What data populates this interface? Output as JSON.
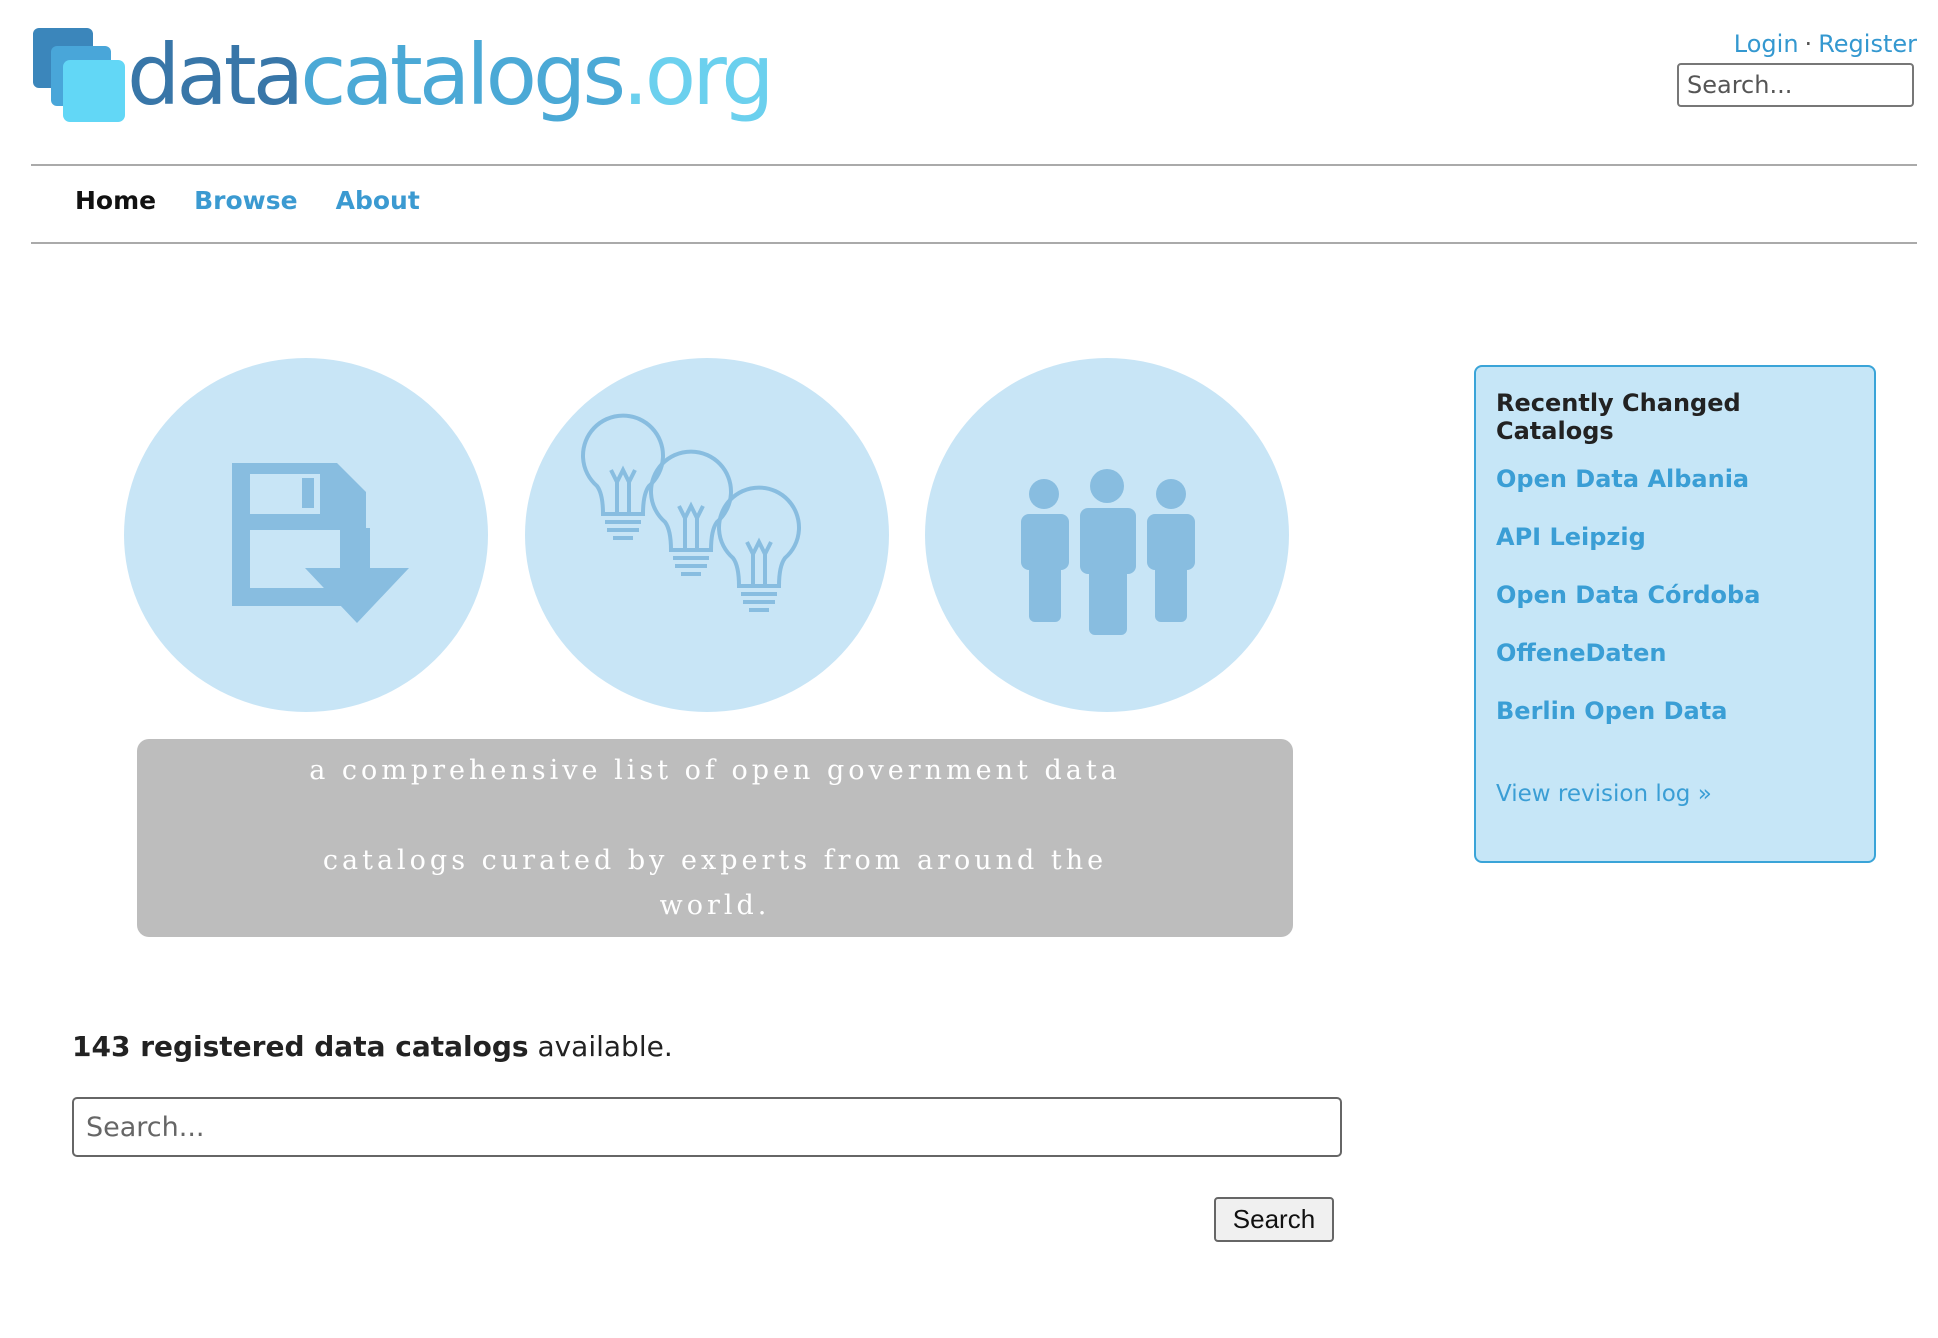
{
  "logo": {
    "part1": "data",
    "part2": "catalogs",
    "part3": ".org"
  },
  "header": {
    "login_label": "Login",
    "separator": "·",
    "register_label": "Register",
    "search_placeholder": "Search..."
  },
  "nav": {
    "items": [
      {
        "label": "Home",
        "active": true
      },
      {
        "label": "Browse",
        "active": false
      },
      {
        "label": "About",
        "active": false
      }
    ]
  },
  "hero": {
    "icons": [
      "floppy-download-icon",
      "lightbulbs-icon",
      "people-icon"
    ],
    "tagline_line1": "a comprehensive list of open government data",
    "tagline_line2": "catalogs curated by experts from around the world."
  },
  "sidebar": {
    "title": "Recently Changed Catalogs",
    "items": [
      {
        "label": "Open Data Albania"
      },
      {
        "label": "API Leipzig"
      },
      {
        "label": "Open Data Córdoba"
      },
      {
        "label": "OffeneDaten"
      },
      {
        "label": "Berlin Open Data"
      }
    ],
    "revision_log_label": "View revision log »"
  },
  "main": {
    "count_bold": "143 registered data catalogs",
    "count_rest": " available.",
    "search_placeholder": "Search...",
    "search_button": "Search"
  },
  "colors": {
    "accent": "#3b9ad1",
    "circle_bg": "#c8e5f6",
    "icon_fill": "#88bde0",
    "sidebar_bg": "#c6e6f7",
    "tagline_bg": "#bdbdbd"
  }
}
